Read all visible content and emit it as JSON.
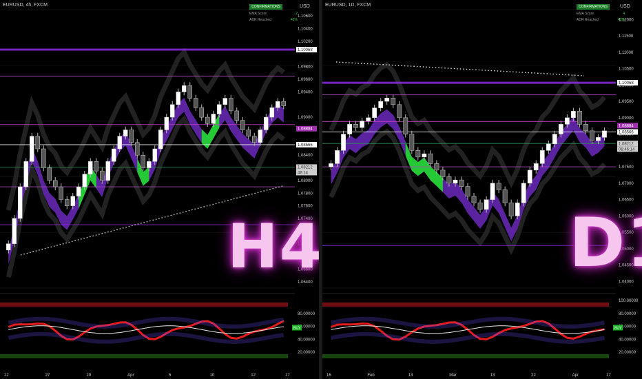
{
  "panels": [
    {
      "id": "h4",
      "symbol": "EURUSD, 4h, FXCM",
      "currency": "USD",
      "badge": "H4",
      "config": {
        "title": "CONFIRMATIONS",
        "rows": [
          {
            "label": "EMA Score",
            "value": "2"
          },
          {
            "label": "ADR Reached",
            "value": "42%"
          }
        ]
      },
      "price_ticks": [
        "1.10600",
        "1.10400",
        "1.10200",
        "1.09800",
        "1.09600",
        "1.09400",
        "1.09000",
        "1.08800",
        "1.08400",
        "1.08200",
        "1.08000",
        "1.07800",
        "1.07600",
        "1.07400",
        "1.07200",
        "1.07000",
        "1.06800",
        "1.06600",
        "1.06400"
      ],
      "price_tags": [
        {
          "text": "1.10068",
          "color": "#ffffff",
          "bg": "#ffffff"
        },
        {
          "text": "1.08212",
          "color": "#333",
          "bg": "#cfcfcf"
        },
        {
          "text": "46:14",
          "color": "#333",
          "bg": "#cfcfcf"
        },
        {
          "text": "1.08884",
          "color": "#fff",
          "bg": "#a22fb0"
        },
        {
          "text": "1.08566",
          "color": "#333",
          "bg": "#ffffff"
        }
      ],
      "osc_ticks": [
        "80.00000",
        "60.00000",
        "40.00000",
        "20.00000"
      ],
      "osc_tag": "BUY",
      "x_labels": [
        "22",
        "27",
        "29",
        "Apr",
        "5",
        "10",
        "12",
        "17"
      ]
    },
    {
      "id": "d1",
      "symbol": "EURUSD, 1D, FXCM",
      "currency": "USD",
      "badge": "D1",
      "config": {
        "title": "CONFIRMATIONS",
        "rows": [
          {
            "label": "EMA Score",
            "value": "4"
          },
          {
            "label": "ADR Reached",
            "value": "42%"
          }
        ]
      },
      "price_ticks": [
        "1.12000",
        "1.11500",
        "1.11000",
        "1.10500",
        "1.10000",
        "1.09500",
        "1.09000",
        "1.08500",
        "1.08000",
        "1.07500",
        "1.07000",
        "1.06500",
        "1.06000",
        "1.05500",
        "1.05000",
        "1.04500",
        "1.04000"
      ],
      "price_tags": [
        {
          "text": "1.10068",
          "color": "#333",
          "bg": "#ffffff"
        },
        {
          "text": "1.08212",
          "color": "#333",
          "bg": "#cfcfcf"
        },
        {
          "text": "08:46:14",
          "color": "#333",
          "bg": "#cfcfcf"
        },
        {
          "text": "1.08884",
          "color": "#fff",
          "bg": "#a22fb0"
        },
        {
          "text": "1.08566",
          "color": "#333",
          "bg": "#ffffff"
        }
      ],
      "osc_ticks": [
        "100.00000",
        "80.00000",
        "60.00000",
        "40.00000",
        "20.00000"
      ],
      "osc_tag": "BUY",
      "x_labels": [
        "16",
        "Feb",
        "13",
        "Mar",
        "13",
        "22",
        "Apr",
        "17"
      ]
    }
  ],
  "colors": {
    "bull": "#ffffff",
    "bear": "#c0c0c0",
    "cloud_purple": "#7a2fd6",
    "cloud_green": "#1fdc2a",
    "level_purple": "#8a2be2",
    "osc_red": "#ff1f1f",
    "buy_green": "#1fb42a"
  },
  "chart_data": [
    {
      "type": "candlestick",
      "title": "EURUSD, 4h, FXCM",
      "ylim": [
        1.063,
        1.107
      ],
      "levels": [
        1.10068,
        1.0965,
        1.08212,
        1.08884,
        1.08566,
        1.079,
        1.073
      ],
      "closes": [
        1.07,
        1.074,
        1.079,
        1.083,
        1.087,
        1.085,
        1.082,
        1.08,
        1.079,
        1.077,
        1.076,
        1.0775,
        1.079,
        1.081,
        1.083,
        1.0815,
        1.08,
        1.083,
        1.085,
        1.087,
        1.088,
        1.086,
        1.084,
        1.082,
        1.083,
        1.085,
        1.088,
        1.09,
        1.092,
        1.094,
        1.095,
        1.093,
        1.0915,
        1.09,
        1.089,
        1.0905,
        1.092,
        1.093,
        1.091,
        1.0895,
        1.088,
        1.087,
        1.086,
        1.088,
        1.09,
        1.0915,
        1.0925,
        1.0918
      ]
    },
    {
      "type": "candlestick",
      "title": "EURUSD, 1D, FXCM",
      "ylim": [
        1.038,
        1.123
      ],
      "levels": [
        1.10068,
        1.097,
        1.08212,
        1.08884,
        1.08566,
        1.075,
        1.051
      ],
      "closes": [
        1.076,
        1.08,
        1.085,
        1.088,
        1.087,
        1.089,
        1.09,
        1.093,
        1.095,
        1.096,
        1.094,
        1.09,
        1.085,
        1.08,
        1.078,
        1.079,
        1.076,
        1.074,
        1.072,
        1.07,
        1.071,
        1.069,
        1.066,
        1.064,
        1.062,
        1.065,
        1.07,
        1.068,
        1.064,
        1.06,
        1.064,
        1.07,
        1.074,
        1.076,
        1.08,
        1.082,
        1.085,
        1.088,
        1.09,
        1.092,
        1.088,
        1.086,
        1.083,
        1.084,
        1.086
      ]
    }
  ]
}
